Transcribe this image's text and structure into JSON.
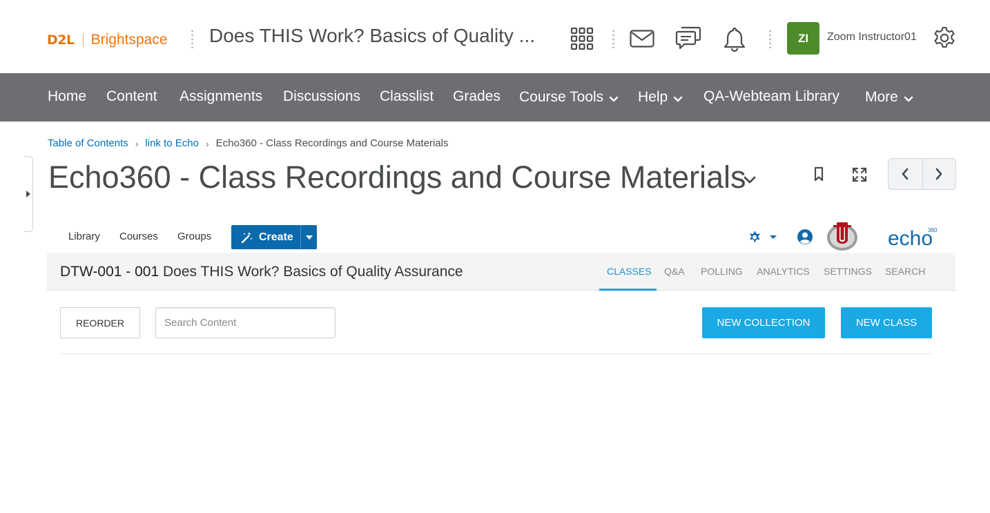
{
  "header": {
    "logo": {
      "brand": "D2L",
      "product": "Brightspace"
    },
    "course_title": "Does THIS Work? Basics of Quality ...",
    "user": {
      "initials": "ZI",
      "name": "Zoom Instructor01"
    },
    "icons": [
      "app-grid-icon",
      "mail-icon",
      "chat-icon",
      "bell-icon",
      "gear-icon"
    ]
  },
  "navbar": {
    "items": [
      {
        "label": "Home"
      },
      {
        "label": "Content"
      },
      {
        "label": "Assignments"
      },
      {
        "label": "Discussions"
      },
      {
        "label": "Classlist"
      },
      {
        "label": "Grades"
      },
      {
        "label": "Course Tools",
        "dropdown": true
      },
      {
        "label": "Help",
        "dropdown": true
      },
      {
        "label": "QA-Webteam Library"
      },
      {
        "label": "More",
        "dropdown": true
      }
    ]
  },
  "breadcrumb": {
    "items": [
      "Table of Contents",
      "link to Echo"
    ],
    "current": "Echo360 - Class Recordings and Course Materials",
    "separator": "›"
  },
  "page": {
    "title": "Echo360 - Class Recordings and Course Materials"
  },
  "echo": {
    "nav": {
      "library": "Library",
      "courses": "Courses",
      "groups": "Groups"
    },
    "create_label": "Create",
    "logo_text": "echo",
    "logo_superscript": "360",
    "course": {
      "code": "DTW-001 - 001",
      "name": "Does THIS Work? Basics of Quality Assurance"
    },
    "tabs": [
      {
        "label": "CLASSES",
        "active": true
      },
      {
        "label": "Q&A"
      },
      {
        "label": "POLLING"
      },
      {
        "label": "ANALYTICS"
      },
      {
        "label": "SETTINGS"
      },
      {
        "label": "SEARCH"
      }
    ],
    "toolbar": {
      "reorder_label": "REORDER",
      "search_placeholder": "Search Content",
      "search_value": "",
      "new_collection_label": "NEW COLLECTION",
      "new_class_label": "NEW CLASS"
    }
  },
  "colors": {
    "brand_orange": "#e87511",
    "nav_bg": "#6d6e71",
    "link_blue": "#006fbf",
    "avatar_green": "#4e8c2b",
    "echo_create_blue": "#0b6aad",
    "echo_action_blue": "#19a9e5"
  }
}
